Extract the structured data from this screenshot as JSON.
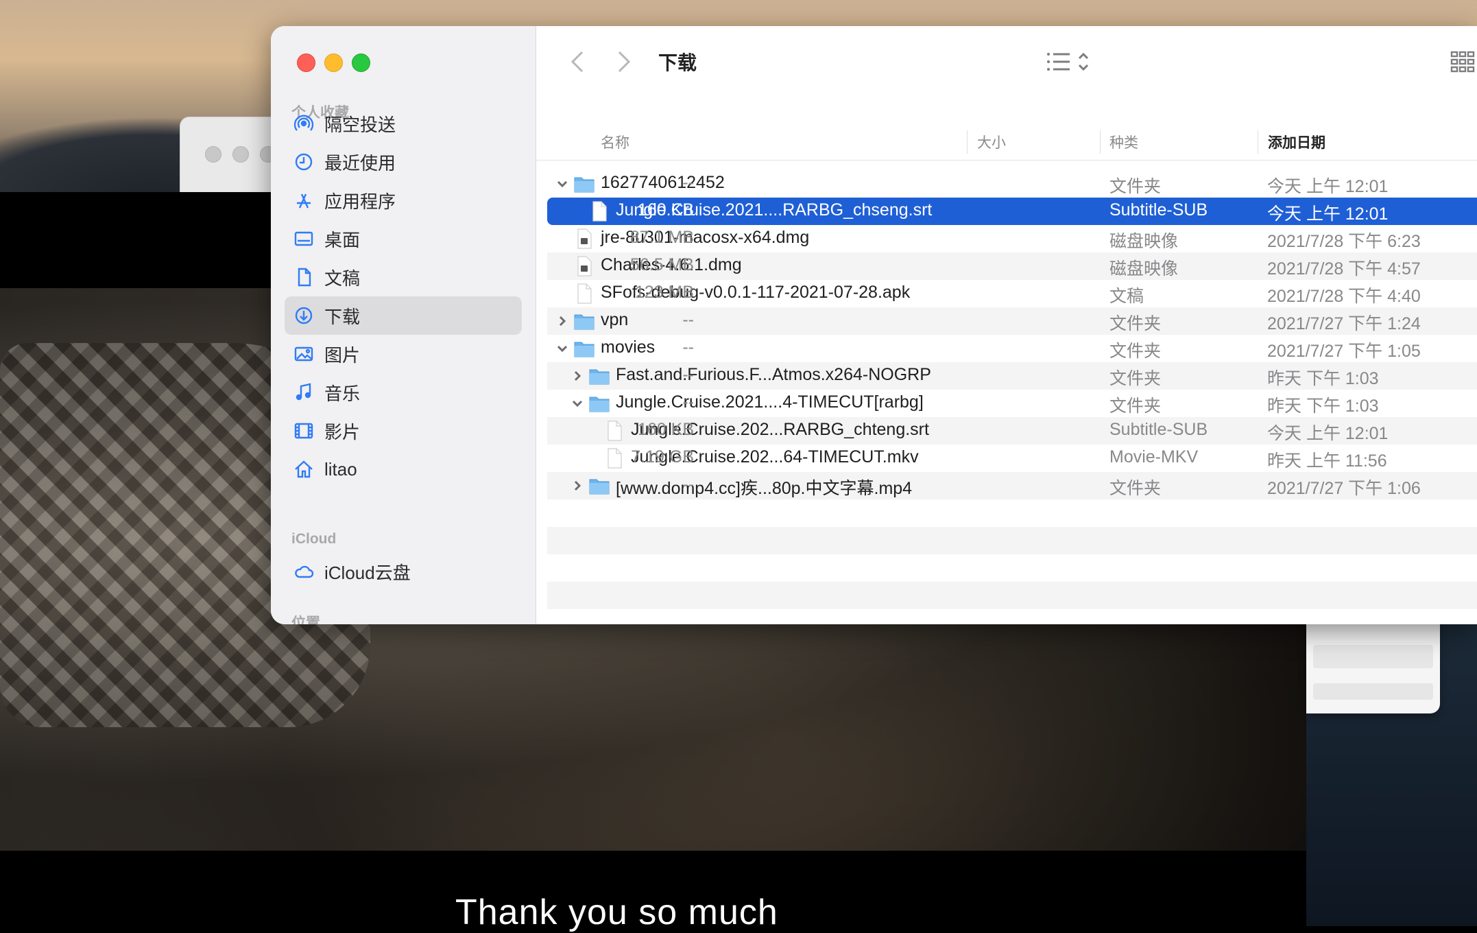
{
  "background": {
    "subtitle_text": "Thank you so much"
  },
  "sidebar": {
    "section_favorites": "个人收藏",
    "section_icloud": "iCloud",
    "section_locations": "位置",
    "favorites": [
      {
        "label": "隔空投送",
        "icon": "airdrop-icon"
      },
      {
        "label": "最近使用",
        "icon": "clock-icon"
      },
      {
        "label": "应用程序",
        "icon": "applications-icon"
      },
      {
        "label": "桌面",
        "icon": "desktop-icon"
      },
      {
        "label": "文稿",
        "icon": "document-icon"
      },
      {
        "label": "下载",
        "icon": "download-icon",
        "active": true
      },
      {
        "label": "图片",
        "icon": "photo-icon"
      },
      {
        "label": "音乐",
        "icon": "music-icon"
      },
      {
        "label": "影片",
        "icon": "film-icon"
      },
      {
        "label": "litao",
        "icon": "home-icon"
      }
    ],
    "icloud": [
      {
        "label": "iCloud云盘",
        "icon": "cloud-icon"
      }
    ]
  },
  "toolbar": {
    "title": "下载",
    "back_icon": "chevron-left-icon",
    "forward_icon": "chevron-right-icon",
    "view_icon": "list-view-icon",
    "group_icon": "group-icon",
    "share_icon": "share-icon",
    "tag_icon": "tag-icon",
    "more_icon": "ellipsis-circle-icon"
  },
  "columns": {
    "name": "名称",
    "size": "大小",
    "kind": "种类",
    "date": "添加日期"
  },
  "accent_color": "#1f5fd6",
  "files": [
    {
      "name": "1627740612452",
      "size": "--",
      "kind": "文件夹",
      "date": "今天 上午 12:01",
      "type": "folder",
      "level": 0,
      "expanded": true
    },
    {
      "name": "Jungle.Cruise.2021....RARBG_chseng.srt",
      "size": "160 KB",
      "kind": "Subtitle-SUB",
      "date": "今天 上午 12:01",
      "type": "file",
      "level": 1,
      "selected": true
    },
    {
      "name": "jre-8u301-macosx-x64.dmg",
      "size": "87.1 MB",
      "kind": "磁盘映像",
      "date": "2021/7/28 下午 6:23",
      "type": "dmg",
      "level": 0
    },
    {
      "name": "Charles-4.6.1.dmg",
      "size": "56.5 MB",
      "kind": "磁盘映像",
      "date": "2021/7/28 下午 4:57",
      "type": "dmg",
      "level": 0
    },
    {
      "name": "SFofs-debug-v0.0.1-117-2021-07-28.apk",
      "size": "123 MB",
      "kind": "文稿",
      "date": "2021/7/28 下午 4:40",
      "type": "file",
      "level": 0
    },
    {
      "name": "vpn",
      "size": "--",
      "kind": "文件夹",
      "date": "2021/7/27 下午 1:24",
      "type": "folder",
      "level": 0,
      "expanded": false
    },
    {
      "name": "movies",
      "size": "--",
      "kind": "文件夹",
      "date": "2021/7/27 下午 1:05",
      "type": "folder",
      "level": 0,
      "expanded": true
    },
    {
      "name": "Fast.and.Furious.F...Atmos.x264-NOGRP",
      "size": "--",
      "kind": "文件夹",
      "date": "昨天 下午 1:03",
      "type": "folder",
      "level": 1,
      "expanded": false
    },
    {
      "name": "Jungle.Cruise.2021....4-TIMECUT[rarbg]",
      "size": "--",
      "kind": "文件夹",
      "date": "昨天 下午 1:03",
      "type": "folder",
      "level": 1,
      "expanded": true
    },
    {
      "name": "Jungle.Cruise.202...RARBG_chteng.srt",
      "size": "160 KB",
      "kind": "Subtitle-SUB",
      "date": "今天 上午 12:01",
      "type": "file",
      "level": 2
    },
    {
      "name": "Jungle.Cruise.202...64-TIMECUT.mkv",
      "size": "7.19 GB",
      "kind": "Movie-MKV",
      "date": "昨天 上午 11:56",
      "type": "file",
      "level": 2
    },
    {
      "name": "[www.domp4.cc]疾...80p.中文字幕.mp4",
      "size": "--",
      "kind": "文件夹",
      "date": "2021/7/27 下午 1:06",
      "type": "folder",
      "level": 1,
      "expanded": false
    }
  ]
}
